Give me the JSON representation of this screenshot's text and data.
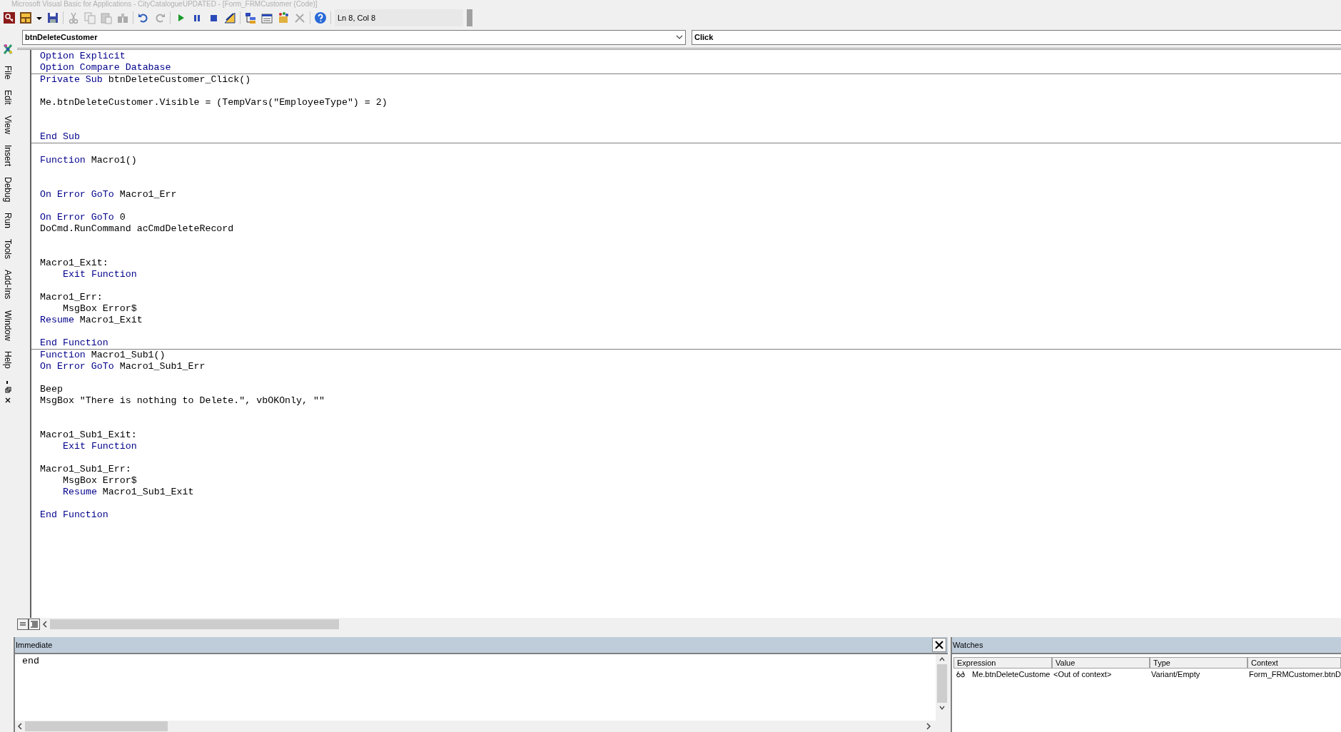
{
  "window": {
    "title": "Microsoft Visual Basic for Applications - CityCatalogueUPDATED - [Form_FRMCustomer (Code)]"
  },
  "toolbar": {
    "position": "Ln 8, Col 8"
  },
  "menu": [
    {
      "label": "File"
    },
    {
      "label": "Edit"
    },
    {
      "label": "View"
    },
    {
      "label": "Insert"
    },
    {
      "label": "Debug"
    },
    {
      "label": "Run"
    },
    {
      "label": "Tools"
    },
    {
      "label": "Add-Ins"
    },
    {
      "label": "Window"
    },
    {
      "label": "Help"
    }
  ],
  "object_box": {
    "value": "btnDeleteCustomer"
  },
  "procedure_box": {
    "value": "Click"
  },
  "code": {
    "procedures": [
      {
        "lines": [
          {
            "kind": "code",
            "parts": [
              {
                "text": "Option Explicit",
                "keyword": true
              }
            ]
          },
          {
            "kind": "code",
            "parts": [
              {
                "text": "Option Compare Database",
                "keyword": true
              }
            ]
          }
        ]
      },
      {
        "lines": [
          {
            "kind": "code",
            "parts": [
              {
                "text": "Private Sub ",
                "keyword": true
              },
              {
                "text": "btnDeleteCustomer_Click()",
                "keyword": false
              }
            ]
          },
          {
            "kind": "blank"
          },
          {
            "kind": "code",
            "parts": [
              {
                "text": "Me.btnDeleteCustomer.Visible = (TempVars(\"EmployeeType\") = 2)",
                "keyword": false
              }
            ]
          },
          {
            "kind": "blank"
          },
          {
            "kind": "blank"
          },
          {
            "kind": "code",
            "parts": [
              {
                "text": "End Sub",
                "keyword": true
              }
            ]
          }
        ]
      },
      {
        "lines": [
          {
            "kind": "blank"
          },
          {
            "kind": "code",
            "parts": [
              {
                "text": "Function ",
                "keyword": true
              },
              {
                "text": "Macro1()",
                "keyword": false
              }
            ]
          },
          {
            "kind": "blank"
          },
          {
            "kind": "blank"
          },
          {
            "kind": "code",
            "parts": [
              {
                "text": "On Error GoTo ",
                "keyword": true
              },
              {
                "text": "Macro1_Err",
                "keyword": false
              }
            ]
          },
          {
            "kind": "blank"
          },
          {
            "kind": "code",
            "parts": [
              {
                "text": "On Error GoTo ",
                "keyword": true
              },
              {
                "text": "0",
                "keyword": false
              }
            ]
          },
          {
            "kind": "code",
            "parts": [
              {
                "text": "DoCmd.RunCommand acCmdDeleteRecord",
                "keyword": false
              }
            ]
          },
          {
            "kind": "blank"
          },
          {
            "kind": "blank"
          },
          {
            "kind": "code",
            "parts": [
              {
                "text": "Macro1_Exit:",
                "keyword": false
              }
            ]
          },
          {
            "kind": "code",
            "indented": true,
            "parts": [
              {
                "text": "Exit Function",
                "keyword": true
              }
            ]
          },
          {
            "kind": "blank"
          },
          {
            "kind": "code",
            "parts": [
              {
                "text": "Macro1_Err:",
                "keyword": false
              }
            ]
          },
          {
            "kind": "code",
            "indented": true,
            "parts": [
              {
                "text": "MsgBox Error$",
                "keyword": false
              }
            ]
          },
          {
            "kind": "code",
            "parts": [
              {
                "text": "Resume ",
                "keyword": true
              },
              {
                "text": "Macro1_Exit",
                "keyword": false
              }
            ]
          },
          {
            "kind": "blank"
          },
          {
            "kind": "code",
            "parts": [
              {
                "text": "End Function",
                "keyword": true
              }
            ]
          }
        ]
      },
      {
        "lines": [
          {
            "kind": "code",
            "parts": [
              {
                "text": "Function ",
                "keyword": true
              },
              {
                "text": "Macro1_Sub1()",
                "keyword": false
              }
            ]
          },
          {
            "kind": "code",
            "parts": [
              {
                "text": "On Error GoTo ",
                "keyword": true
              },
              {
                "text": "Macro1_Sub1_Err",
                "keyword": false
              }
            ]
          },
          {
            "kind": "blank"
          },
          {
            "kind": "code",
            "parts": [
              {
                "text": "Beep",
                "keyword": false
              }
            ]
          },
          {
            "kind": "code",
            "parts": [
              {
                "text": "MsgBox \"There is nothing to Delete.\", vbOKOnly, \"\"",
                "keyword": false
              }
            ]
          },
          {
            "kind": "blank"
          },
          {
            "kind": "blank"
          },
          {
            "kind": "code",
            "parts": [
              {
                "text": "Macro1_Sub1_Exit:",
                "keyword": false
              }
            ]
          },
          {
            "kind": "code",
            "indented": true,
            "parts": [
              {
                "text": "Exit Function",
                "keyword": true
              }
            ]
          },
          {
            "kind": "blank"
          },
          {
            "kind": "code",
            "parts": [
              {
                "text": "Macro1_Sub1_Err:",
                "keyword": false
              }
            ]
          },
          {
            "kind": "code",
            "indented": true,
            "parts": [
              {
                "text": "MsgBox Error$",
                "keyword": false
              }
            ]
          },
          {
            "kind": "code",
            "indented": true,
            "parts": [
              {
                "text": "Resume ",
                "keyword": true
              },
              {
                "text": "Macro1_Sub1_Exit",
                "keyword": false
              }
            ]
          },
          {
            "kind": "blank"
          },
          {
            "kind": "code",
            "parts": [
              {
                "text": "End Function",
                "keyword": true
              }
            ]
          }
        ]
      }
    ]
  },
  "immediate": {
    "title": "Immediate",
    "lines": [
      "end"
    ]
  },
  "watches": {
    "title": "Watches",
    "columns": [
      "Expression",
      "Value",
      "Type",
      "Context"
    ],
    "rows": [
      {
        "cells": [
          "Me.btnDeleteCustome",
          "<Out of context>",
          "Variant/Empty",
          "Form_FRMCustomer.btnD"
        ]
      }
    ]
  }
}
